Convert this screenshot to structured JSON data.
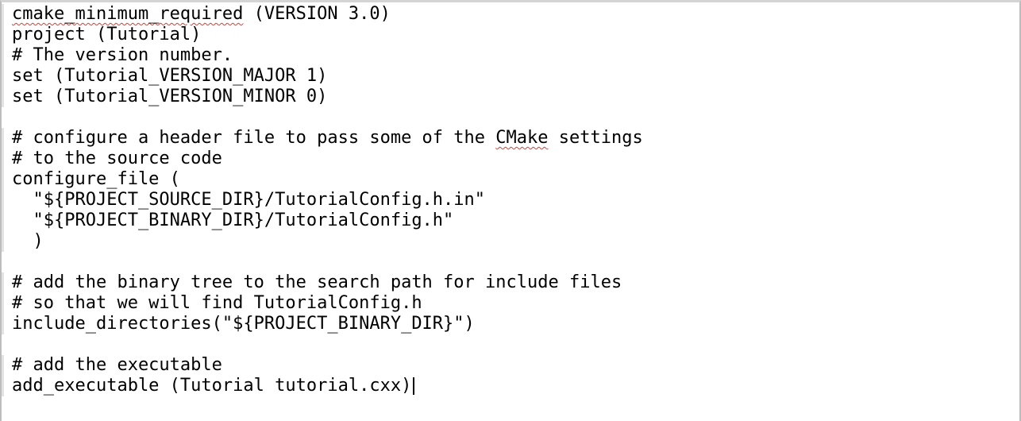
{
  "editor": {
    "lines": [
      {
        "pre": "",
        "misspelled": "cmake_minimum_required",
        "post": " (VERSION 3.0)"
      },
      {
        "pre": "project (Tutorial)",
        "misspelled": "",
        "post": ""
      },
      {
        "pre": "# The version number.",
        "misspelled": "",
        "post": ""
      },
      {
        "pre": "set (Tutorial_VERSION_MAJOR 1)",
        "misspelled": "",
        "post": ""
      },
      {
        "pre": "set (Tutorial_VERSION_MINOR 0)",
        "misspelled": "",
        "post": ""
      },
      {
        "pre": "",
        "misspelled": "",
        "post": ""
      },
      {
        "pre": "# configure a header file to pass some of the ",
        "misspelled": "CMake",
        "post": " settings"
      },
      {
        "pre": "# to the source code",
        "misspelled": "",
        "post": ""
      },
      {
        "pre": "configure_file (",
        "misspelled": "",
        "post": ""
      },
      {
        "pre": "  \"${PROJECT_SOURCE_DIR}/TutorialConfig.h.in\"",
        "misspelled": "",
        "post": ""
      },
      {
        "pre": "  \"${PROJECT_BINARY_DIR}/TutorialConfig.h\"",
        "misspelled": "",
        "post": ""
      },
      {
        "pre": "  )",
        "misspelled": "",
        "post": ""
      },
      {
        "pre": "",
        "misspelled": "",
        "post": ""
      },
      {
        "pre": "# add the binary tree to the search path for include files",
        "misspelled": "",
        "post": ""
      },
      {
        "pre": "# so that we will find TutorialConfig.h",
        "misspelled": "",
        "post": ""
      },
      {
        "pre": "include_directories(\"${PROJECT_BINARY_DIR}\")",
        "misspelled": "",
        "post": ""
      },
      {
        "pre": "",
        "misspelled": "",
        "post": ""
      },
      {
        "pre": "# add the executable",
        "misspelled": "",
        "post": ""
      },
      {
        "pre": "add_executable (Tutorial tutorial.cxx)",
        "misspelled": "",
        "post": ""
      }
    ]
  }
}
